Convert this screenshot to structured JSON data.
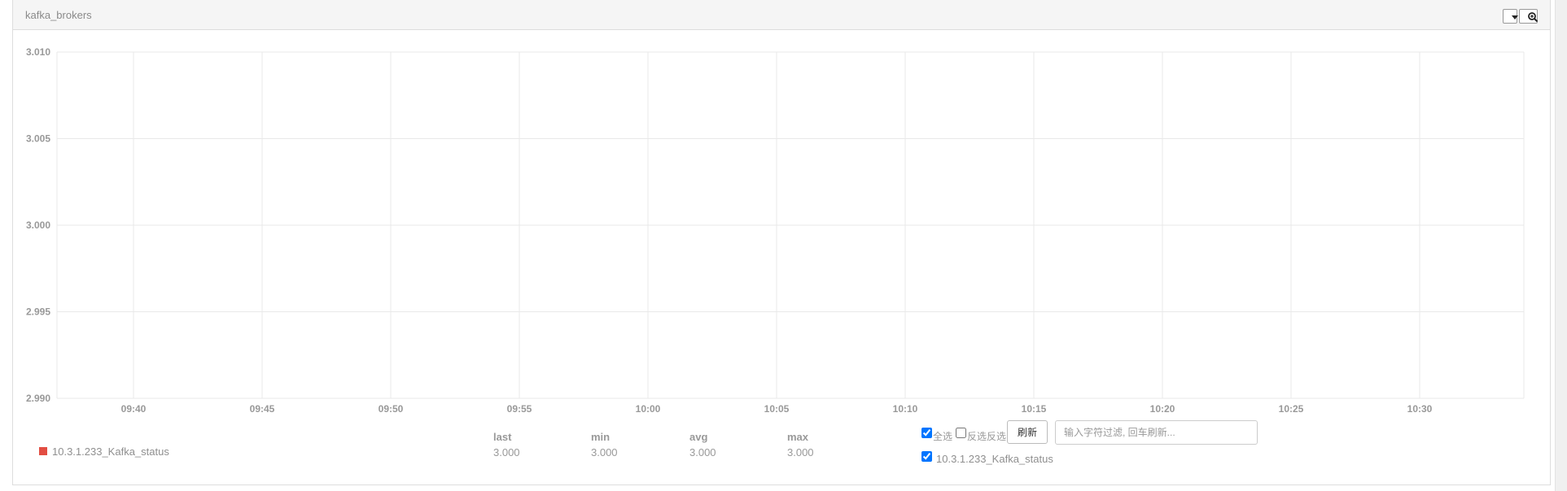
{
  "panel": {
    "title": "kafka_brokers",
    "dropdown_icon": "caret-down-icon",
    "zoom_icon": "zoom-in-icon"
  },
  "chart_data": {
    "type": "line",
    "x": [
      "09:40",
      "09:45",
      "09:50",
      "09:55",
      "10:00",
      "10:05",
      "10:10",
      "10:15",
      "10:20",
      "10:25",
      "10:30"
    ],
    "x_tick_labels": [
      "09:40",
      "09:45",
      "09:50",
      "09:55",
      "10:00",
      "10:05",
      "10:10",
      "10:15",
      "10:20",
      "10:25",
      "10:30"
    ],
    "y_tick_labels": [
      "3.010",
      "3.005",
      "3.000",
      "2.995",
      "2.990"
    ],
    "ylim": [
      2.99,
      3.01
    ],
    "grid": true,
    "legend_placement": "bottom-left",
    "series": [
      {
        "name": "10.3.1.233_Kafka_status",
        "color": "#e24d42",
        "last": "3.000",
        "min": "3.000",
        "avg": "3.000",
        "max": "3.000"
      }
    ]
  },
  "legend": {
    "headers": {
      "last": "last",
      "min": "min",
      "avg": "avg",
      "max": "max"
    },
    "series_name": "10.3.1.233_Kafka_status",
    "swatch_color": "#e24d42",
    "last": "3.000",
    "min": "3.000",
    "avg": "3.000",
    "max": "3.000"
  },
  "controls": {
    "select_all_label": "全选",
    "select_all_checked": true,
    "invert_label": "反选反选",
    "invert_checked": false,
    "refresh_label": "刷新",
    "filter_placeholder": "输入字符过滤, 回车刷新...",
    "series_checkbox_label": "10.3.1.233_Kafka_status",
    "series_checked": true
  }
}
